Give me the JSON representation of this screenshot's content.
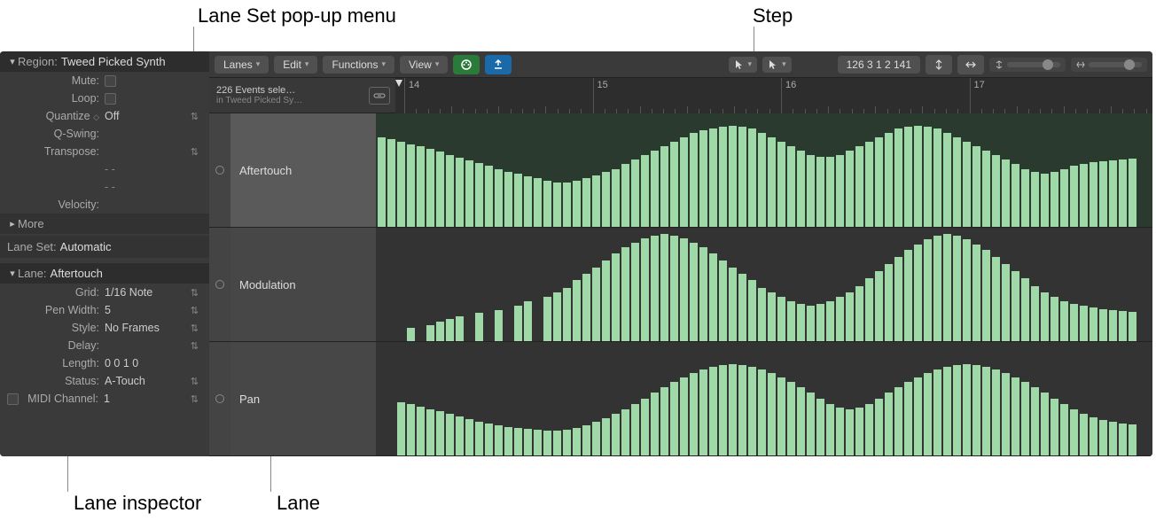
{
  "callouts": {
    "laneSet": "Lane Set pop-up menu",
    "step": "Step",
    "laneInspector": "Lane inspector",
    "lane": "Lane"
  },
  "inspector": {
    "region": {
      "label": "Region:",
      "value": "Tweed Picked Synth"
    },
    "rows": {
      "mute": "Mute:",
      "loop": "Loop:",
      "quantize": {
        "label": "Quantize",
        "value": "Off"
      },
      "qswing": "Q-Swing:",
      "transpose": "Transpose:",
      "dash1": "- -",
      "dash2": "- -",
      "velocity": "Velocity:"
    },
    "more": "More",
    "laneSet": {
      "label": "Lane Set:",
      "value": "Automatic"
    },
    "lane": {
      "label": "Lane:",
      "value": "Aftertouch"
    },
    "laneRows": {
      "grid": {
        "label": "Grid:",
        "value": "1/16 Note"
      },
      "penWidth": {
        "label": "Pen Width:",
        "value": "5"
      },
      "style": {
        "label": "Style:",
        "value": "No Frames"
      },
      "delay": {
        "label": "Delay:",
        "value": ""
      },
      "length": {
        "label": "Length:",
        "value": "0 0 1    0"
      },
      "status": {
        "label": "Status:",
        "value": "A-Touch"
      },
      "midiCh": {
        "label": "MIDI Channel:",
        "value": "1"
      }
    }
  },
  "toolbar": {
    "lanes": "Lanes",
    "edit": "Edit",
    "functions": "Functions",
    "view": "View",
    "position": "126   3 1 2 141"
  },
  "info": {
    "line1": "226 Events sele…",
    "line2": "in Tweed Picked Sy…"
  },
  "ruler": {
    "marks": [
      "14",
      "15",
      "16",
      "17"
    ]
  },
  "lanes": [
    "Aftertouch",
    "Modulation",
    "Pan"
  ],
  "chart_data": [
    {
      "type": "bar",
      "title": "Aftertouch",
      "ylim": [
        0,
        127
      ],
      "values": [
        100,
        98,
        95,
        92,
        90,
        87,
        84,
        80,
        77,
        74,
        71,
        68,
        65,
        62,
        60,
        57,
        55,
        52,
        50,
        50,
        52,
        55,
        58,
        62,
        65,
        70,
        75,
        80,
        85,
        90,
        95,
        100,
        105,
        108,
        110,
        112,
        113,
        112,
        110,
        105,
        100,
        95,
        90,
        85,
        80,
        78,
        78,
        80,
        85,
        90,
        95,
        100,
        105,
        110,
        112,
        113,
        112,
        110,
        105,
        100,
        95,
        90,
        85,
        80,
        75,
        70,
        65,
        62,
        60,
        62,
        65,
        68,
        70,
        72,
        73,
        74,
        75,
        76
      ]
    },
    {
      "type": "bar",
      "title": "Modulation",
      "ylim": [
        0,
        127
      ],
      "values": [
        0,
        0,
        0,
        15,
        0,
        18,
        22,
        25,
        28,
        0,
        32,
        0,
        35,
        0,
        40,
        45,
        0,
        50,
        55,
        60,
        68,
        75,
        82,
        90,
        98,
        105,
        110,
        115,
        118,
        120,
        118,
        115,
        110,
        105,
        98,
        90,
        82,
        75,
        68,
        60,
        55,
        50,
        45,
        42,
        40,
        42,
        45,
        50,
        55,
        62,
        70,
        78,
        86,
        94,
        102,
        108,
        114,
        118,
        120,
        118,
        114,
        108,
        102,
        94,
        86,
        78,
        70,
        62,
        55,
        50,
        45,
        42,
        40,
        38,
        36,
        35,
        34,
        33
      ]
    },
    {
      "type": "bar",
      "title": "Pan",
      "ylim": [
        0,
        127
      ],
      "values": [
        0,
        0,
        60,
        58,
        55,
        52,
        50,
        47,
        44,
        41,
        38,
        36,
        34,
        32,
        31,
        30,
        29,
        28,
        28,
        29,
        31,
        34,
        38,
        42,
        47,
        52,
        58,
        64,
        70,
        76,
        82,
        87,
        92,
        96,
        99,
        101,
        102,
        101,
        99,
        96,
        92,
        87,
        82,
        76,
        70,
        64,
        58,
        54,
        52,
        54,
        58,
        64,
        70,
        76,
        82,
        87,
        92,
        96,
        99,
        101,
        102,
        101,
        99,
        96,
        92,
        87,
        82,
        76,
        70,
        64,
        58,
        52,
        47,
        43,
        40,
        38,
        36,
        35
      ]
    }
  ]
}
